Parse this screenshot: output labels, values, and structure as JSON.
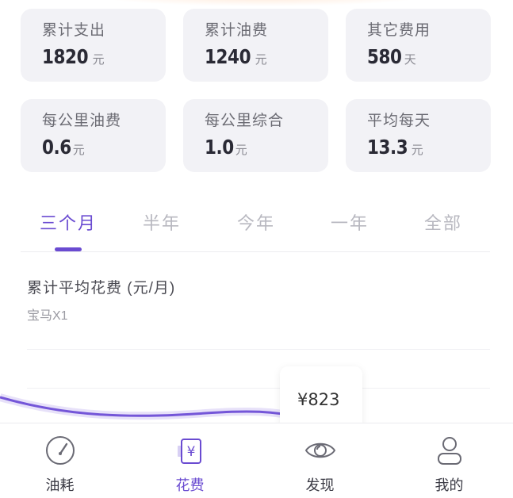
{
  "stats": [
    {
      "label": "累计支出",
      "value": "1820",
      "unit": "元"
    },
    {
      "label": "累计油费",
      "value": "1240",
      "unit": "元"
    },
    {
      "label": "其它费用",
      "value": "580",
      "unit": "天"
    },
    {
      "label": "每公里油费",
      "value": "0.6",
      "unit": "元"
    },
    {
      "label": "每公里综合",
      "value": "1.0",
      "unit": "元"
    },
    {
      "label": "平均每天",
      "value": "13.3",
      "unit": "元"
    }
  ],
  "period_tabs": [
    "三个月",
    "半年",
    "今年",
    "一年",
    "全部"
  ],
  "active_period": "三个月",
  "section": {
    "title": "累计平均花费 (元/月)",
    "subtitle": "宝马X1"
  },
  "tooltip": {
    "value": "¥823"
  },
  "colors": {
    "accent": "#6a4bd1",
    "card": "#f2f2f6",
    "curve": "#7456d8"
  },
  "tabbar": [
    {
      "label": "油耗",
      "icon": "gauge-icon"
    },
    {
      "label": "花费",
      "icon": "yen-bill-icon",
      "active": true
    },
    {
      "label": "发现",
      "icon": "eye-icon"
    },
    {
      "label": "我的",
      "icon": "user-icon"
    }
  ]
}
